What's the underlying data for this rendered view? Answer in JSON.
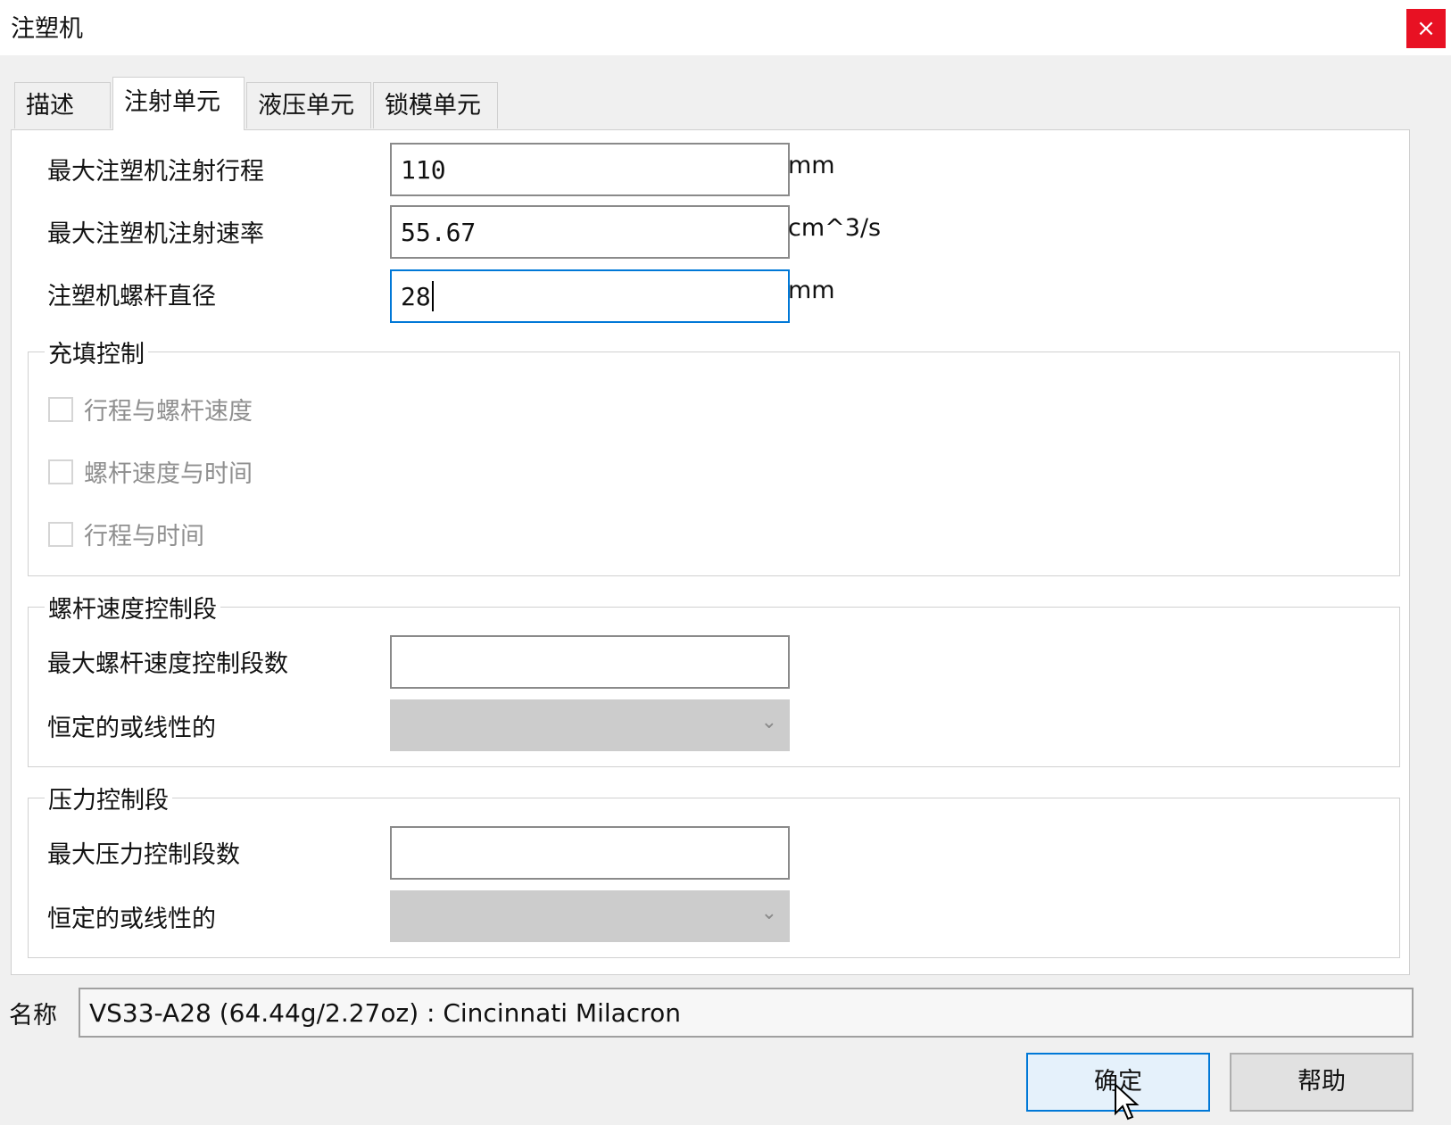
{
  "window": {
    "title": "注塑机",
    "close_symbol": "×"
  },
  "tabs": [
    {
      "label": "描述"
    },
    {
      "label": "注射单元",
      "active": true
    },
    {
      "label": "液压单元"
    },
    {
      "label": "锁模单元"
    }
  ],
  "fields": [
    {
      "label": "最大注塑机注射行程",
      "value": "110",
      "unit": "mm"
    },
    {
      "label": "最大注塑机注射速率",
      "value": "55.67",
      "unit": "cm^3/s"
    },
    {
      "label": "注塑机螺杆直径",
      "value": "28",
      "unit": "mm",
      "focused": true
    }
  ],
  "fill_control": {
    "title": "充填控制",
    "options": [
      {
        "label": "行程与螺杆速度",
        "checked": false,
        "enabled": false
      },
      {
        "label": "螺杆速度与时间",
        "checked": false,
        "enabled": false
      },
      {
        "label": "行程与时间",
        "checked": false,
        "enabled": false
      }
    ]
  },
  "screw_speed_group": {
    "title": "螺杆速度控制段",
    "max_label": "最大螺杆速度控制段数",
    "max_value": "",
    "mode_label": "恒定的或线性的",
    "mode_value": ""
  },
  "pressure_group": {
    "title": "压力控制段",
    "max_label": "最大压力控制段数",
    "max_value": "",
    "mode_label": "恒定的或线性的",
    "mode_value": ""
  },
  "name": {
    "label": "名称",
    "value": "VS33-A28 (64.44g/2.27oz) : Cincinnati Milacron"
  },
  "buttons": {
    "ok": "确定",
    "help": "帮助"
  },
  "colors": {
    "accent": "#0078d7",
    "close": "#e81123",
    "disabled_combo": "#cccccc"
  }
}
